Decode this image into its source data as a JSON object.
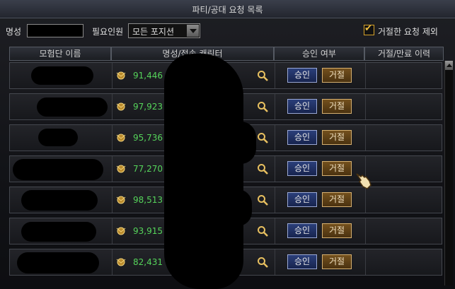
{
  "window": {
    "title": "파티/공대 요청 목록"
  },
  "filters": {
    "fame_label": "명성",
    "fame_value": "",
    "required_label": "필요인원",
    "position_select": "모든 포지션",
    "ghost_text": "",
    "exclude_rejected_label": "거절한 요청 제외",
    "exclude_rejected_checked": true
  },
  "columns": [
    "모험단 이름",
    "명성/접속 캐릭터",
    "승인 여부",
    "거절/만료 이력"
  ],
  "buttons": {
    "approve": "승인",
    "reject": "거절"
  },
  "rows": [
    {
      "fame": "91,446"
    },
    {
      "fame": "97,923"
    },
    {
      "fame": "95,736"
    },
    {
      "fame": "77,270"
    },
    {
      "fame": "98,513"
    },
    {
      "fame": "93,915"
    },
    {
      "fame": "82,431"
    }
  ],
  "colors": {
    "fame_text": "#55d35a",
    "approve_bg": "#1f2f66",
    "reject_bg": "#5e4016"
  }
}
